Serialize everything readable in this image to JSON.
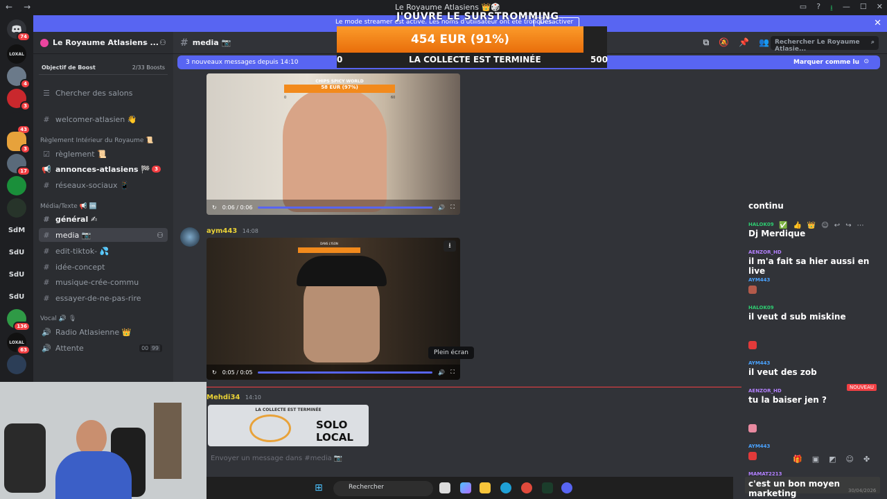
{
  "window": {
    "title": "Le Royaume Atlasiens 👑🎲",
    "back_icon": "←",
    "forward_icon": "→"
  },
  "streamer_banner": {
    "text": "Le mode streamer est activé. Les noms d'utilisateur ont été tronqués.",
    "button": "Désactiver"
  },
  "overlay": {
    "title": "J'OUVRE LE SURSTROMMING",
    "amount": "454 EUR (91%)",
    "min": "0",
    "status": "LA COLLECTE EST TERMINÉE",
    "max": "500"
  },
  "server": {
    "name": "Le Royaume Atlasiens ...",
    "boost_label": "Objectif de Boost",
    "boost_count": "2/33 Boosts",
    "search_channels": "Chercher des salons"
  },
  "guild_badges": [
    "74",
    "4",
    "3",
    "43",
    "3",
    "17",
    "136",
    "63"
  ],
  "guild_text": [
    "SdM",
    "SdU",
    "SdU",
    "SdU"
  ],
  "channels": {
    "welcomer": "welcomer-atlasien 👋",
    "cat_rules": "Règlement Intérieur du Royaume 📜",
    "reglement": "règlement 📜",
    "annonces": "annonces-atlasiens 🏁",
    "annonces_badge": "3",
    "reseaux": "réseaux-sociaux 📱",
    "cat_media": "Média/Texte 📢 🆒",
    "general": "général ✍",
    "media": "media 📷",
    "edit": "edit-tiktok- 💦",
    "idee": "idée-concept",
    "musique": "musique-crée-commu",
    "essayer": "essayer-de-ne-pas-rire",
    "cat_vocal": "Vocal 🔊 🎙",
    "radio": "Radio Atlasienne 👑",
    "attente": "Attente",
    "attente_a": "00",
    "attente_b": "99"
  },
  "header": {
    "channel": "media 📷",
    "search_placeholder": "Rechercher Le Royaume Atlasie..."
  },
  "new_messages": {
    "text": "3 nouveaux messages depuis 14:10",
    "mark": "Marquer comme lu"
  },
  "video1": {
    "time": "0:06 / 0:06",
    "overlay_title": "CHIPS SPICY WORLD",
    "overlay_amount": "58 EUR (97%)",
    "overlay_min": "0",
    "overlay_max": "60"
  },
  "message2": {
    "author": "aym443",
    "time": "14:08"
  },
  "video2": {
    "time": "0:05 / 0:05",
    "overlay_title": "DANS L'ISON"
  },
  "tooltip": "Plein écran",
  "message3": {
    "author": "Mehdi34",
    "time": "14:10"
  },
  "embed": {
    "title": "LA COLLECTE EST TERMINÉE",
    "line1": "SOLO",
    "line2": "LOCAL"
  },
  "compose_placeholder": "Envoyer un message dans #media 📷",
  "chat": [
    {
      "user": "",
      "text": "continu",
      "color": "#ffffff"
    },
    {
      "user": "HALOK09",
      "text": "Dj Merdique",
      "color": "#2ecc71"
    },
    {
      "user": "AENZOR_HD",
      "text": "il m'a fait sa hier aussi en live",
      "color": "#b380ff"
    },
    {
      "user": "AYM443",
      "text": "",
      "color": "#4aa3ff"
    },
    {
      "user": "HALOK09",
      "text": "il veut d sub miskine",
      "color": "#2ecc71"
    },
    {
      "user": "",
      "text": "",
      "color": "#ff3b3b"
    },
    {
      "user": "AYM443",
      "text": "il veut des zob",
      "color": "#4aa3ff"
    },
    {
      "user": "AENZOR_HD",
      "text": "tu la baiser jen ?",
      "color": "#b380ff"
    },
    {
      "user": "",
      "text": "",
      "color": "#ff3b3b"
    },
    {
      "user": "AYM443",
      "text": "",
      "color": "#4aa3ff"
    },
    {
      "user": "MAMAT2213",
      "text": "c'est un bon moyen marketing",
      "color": "#b380ff"
    }
  ],
  "chat_new_badge": "NOUVEAU",
  "taskbar": {
    "search": "Rechercher",
    "clock": "30/04/2026"
  },
  "colors": {
    "blurple": "#5865f2",
    "orange": "#f28a1c",
    "red": "#f23f43"
  }
}
